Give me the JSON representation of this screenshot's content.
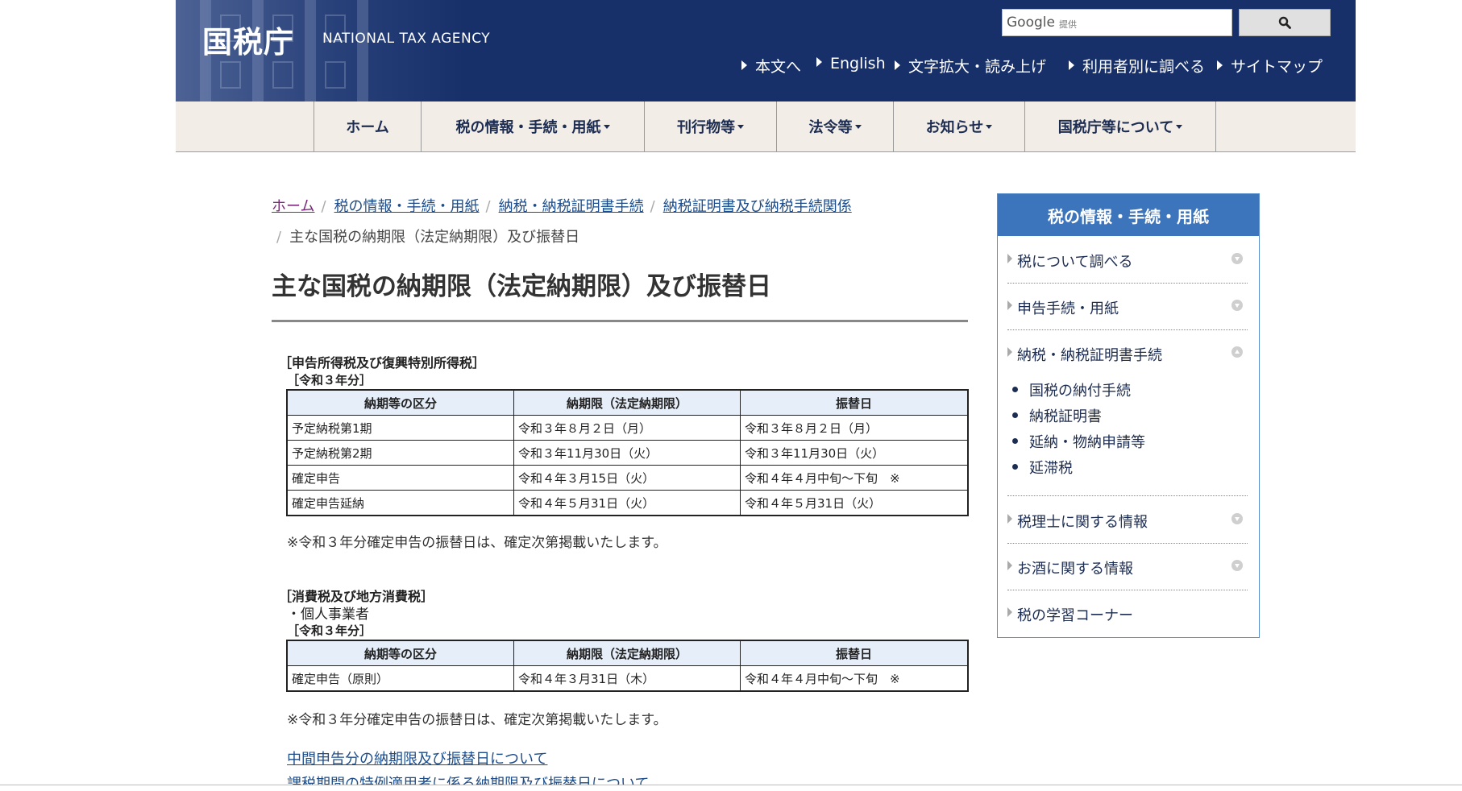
{
  "header": {
    "logo_jp": "国税庁",
    "logo_en": "NATIONAL TAX AGENCY",
    "search": {
      "brand": "Google",
      "provided": "提供",
      "placeholder": ""
    },
    "utility_nav": [
      "本文へ",
      "English",
      "文字拡大・読み上げ",
      "利用者別に調べる",
      "サイトマップ"
    ]
  },
  "global_nav": [
    "ホーム",
    "税の情報・手続・用紙",
    "刊行物等",
    "法令等",
    "お知らせ",
    "国税庁等について"
  ],
  "breadcrumb": {
    "links": [
      "ホーム",
      "税の情報・手続・用紙",
      "納税・納税証明書手続",
      "納税証明書及び納税手続関係"
    ],
    "current": "主な国税の納期限（法定納期限）及び振替日"
  },
  "page_title": "主な国税の納期限（法定納期限）及び振替日",
  "section1": {
    "heading": "［申告所得税及び復興特別所得税］",
    "year": "［令和３年分］",
    "headers": [
      "納期等の区分",
      "納期限（法定納期限）",
      "振替日"
    ],
    "rows": [
      [
        "予定納税第1期",
        "令和３年８月２日（月）",
        "令和３年８月２日（月）"
      ],
      [
        "予定納税第2期",
        "令和３年11月30日（火）",
        "令和３年11月30日（火）"
      ],
      [
        "確定申告",
        "令和４年３月15日（火）",
        "令和４年４月中旬～下旬　※"
      ],
      [
        "確定申告延納",
        "令和４年５月31日（火）",
        "令和４年５月31日（火）"
      ]
    ],
    "note": "※令和３年分確定申告の振替日は、確定次第掲載いたします。"
  },
  "section2": {
    "heading": "［消費税及び地方消費税］",
    "sub": "・個人事業者",
    "year": "［令和３年分］",
    "headers": [
      "納期等の区分",
      "納期限（法定納期限）",
      "振替日"
    ],
    "rows": [
      [
        "確定申告（原則）",
        "令和４年３月31日（木）",
        "令和４年４月中旬～下旬　※"
      ]
    ],
    "note": "※令和３年分確定申告の振替日は、確定次第掲載いたします。"
  },
  "links": [
    "中間申告分の納期限及び振替日について",
    "課税期間の特例適用者に係る納期限及び振替日について"
  ],
  "sidebar": {
    "title": "税の情報・手続・用紙",
    "items": [
      {
        "label": "税について調べる",
        "state": "collapsed"
      },
      {
        "label": "申告手続・用紙",
        "state": "collapsed"
      },
      {
        "label": "納税・納税証明書手続",
        "state": "expanded"
      },
      {
        "label": "税理士に関する情報",
        "state": "collapsed"
      },
      {
        "label": "お酒に関する情報",
        "state": "collapsed"
      },
      {
        "label": "税の学習コーナー",
        "state": "none"
      }
    ],
    "subitems": [
      "国税の納付手続",
      "納税証明書",
      "延納・物納申請等",
      "延滞税"
    ]
  },
  "colors": {
    "header_bg": "#18306a",
    "nav_bg": "#f2ede6",
    "sidebar_head": "#3d75bd",
    "table_head": "#e6eef9",
    "link": "#1d4d8a"
  }
}
